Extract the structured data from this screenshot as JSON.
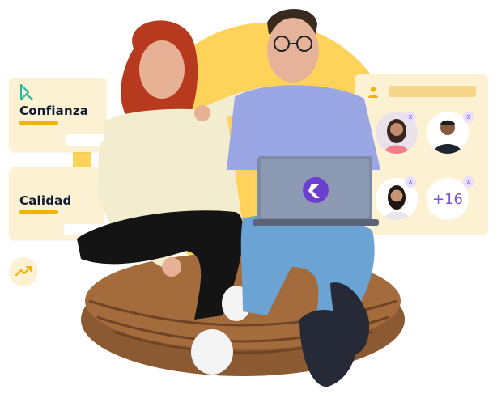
{
  "cards": {
    "confianza": {
      "label": "Confianza",
      "icon": "dk-logo-icon"
    },
    "calidad": {
      "label": "Calidad"
    },
    "trend_icon": "trend-up-icon"
  },
  "panel": {
    "avatars_more": "+16",
    "close_symbol": "x"
  },
  "laptop": {
    "logo_icon": "flutter-logo-icon"
  },
  "colors": {
    "accent_yellow": "#ffd25a",
    "card_bg": "#fdf1d3",
    "bar_yellow": "#f0b400",
    "purple": "#7b53d8",
    "navy": "#0f1b33"
  }
}
